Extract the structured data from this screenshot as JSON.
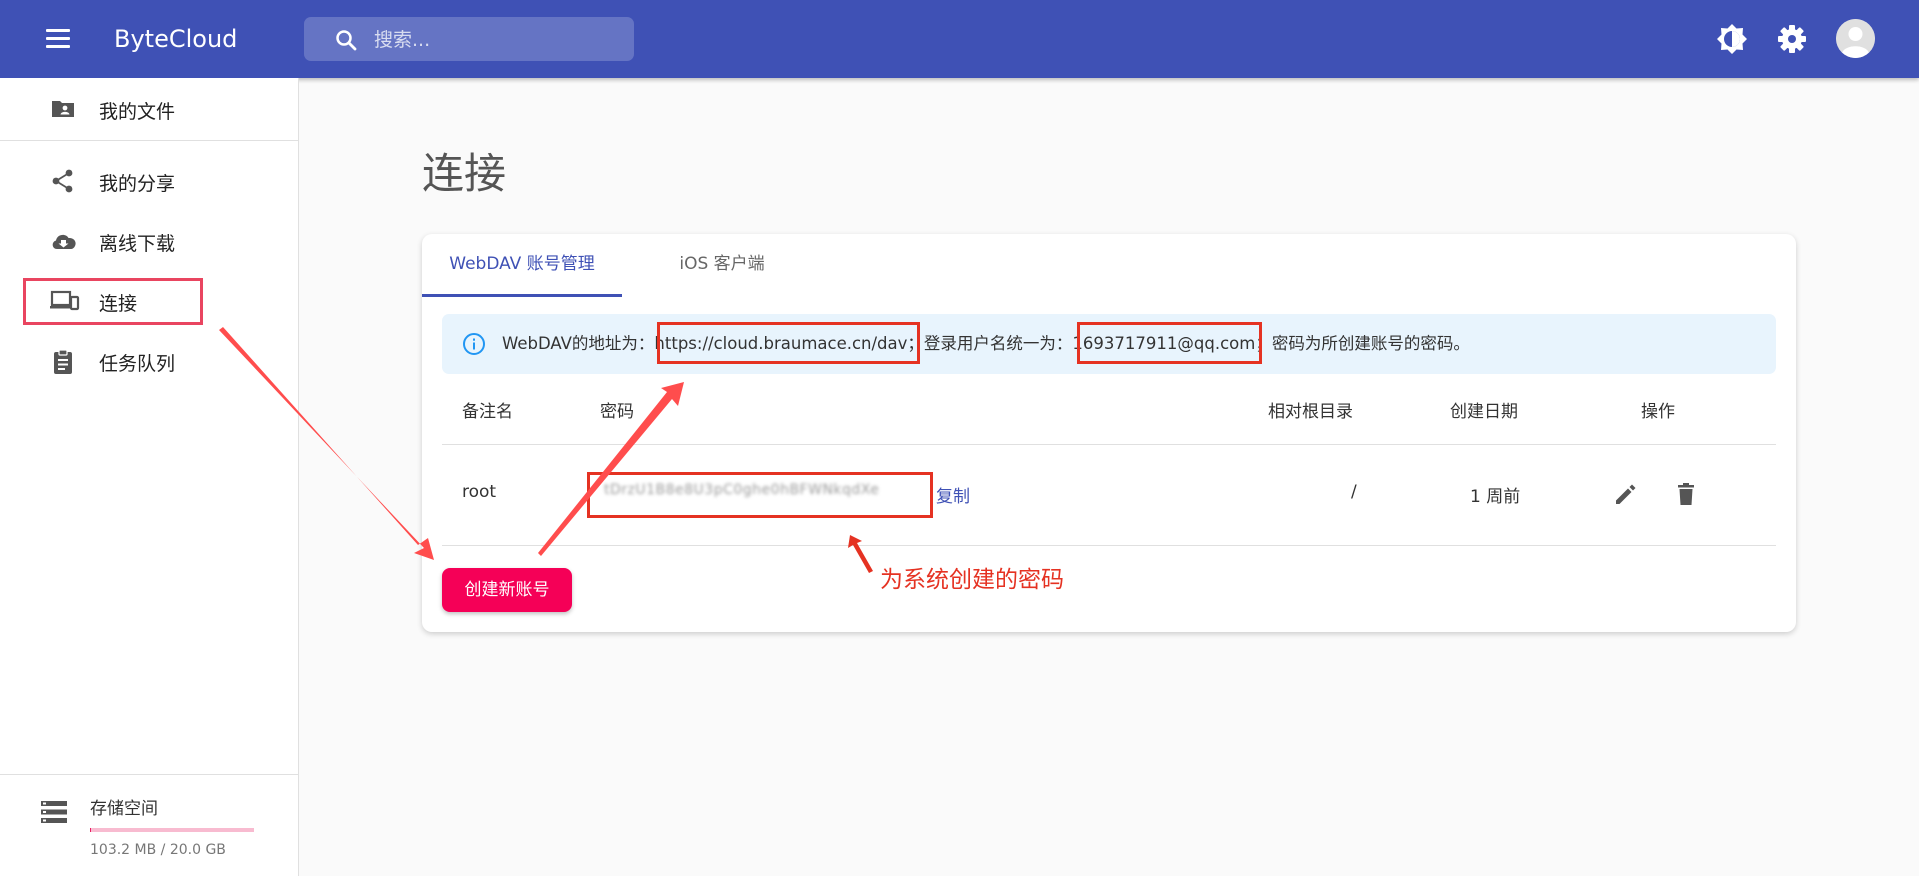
{
  "appbar": {
    "brand": "ByteCloud",
    "search_placeholder": "搜索...",
    "icons": [
      "menu-icon",
      "search-icon",
      "theme-toggle-icon",
      "settings-icon",
      "account-icon"
    ]
  },
  "sidebar": {
    "items": [
      {
        "label": "我的文件",
        "icon": "folder-user-icon"
      },
      {
        "label": "我的分享",
        "icon": "share-icon"
      },
      {
        "label": "离线下载",
        "icon": "cloud-download-icon"
      },
      {
        "label": "连接",
        "icon": "devices-icon"
      },
      {
        "label": "任务队列",
        "icon": "clipboard-icon"
      }
    ],
    "storage": {
      "title": "存储空间",
      "info": "103.2 MB / 20.0 GB",
      "used_fraction": 0.005
    }
  },
  "main": {
    "title": "连接",
    "tabs": [
      {
        "label": "WebDAV 账号管理",
        "active": true
      },
      {
        "label": "iOS 客户端",
        "active": false
      }
    ],
    "info": {
      "prefix": "WebDAV的地址为：",
      "url": "https://cloud.braumace.cn/dav",
      "mid": "；登录用户名统一为：",
      "user": "1693717911@qq.com",
      "suffix": "；密码为所创建账号的密码。"
    },
    "table": {
      "headers": [
        "备注名",
        "密码",
        "相对根目录",
        "创建日期",
        "操作"
      ],
      "rows": [
        {
          "name": "root",
          "password": "tDrzU1B8e8U3pC0ghe0hBFWNkqdXe",
          "copy": "复制",
          "root": "/",
          "date": "1 周前"
        }
      ]
    },
    "create_button": "创建新账号"
  },
  "annotation": {
    "text": "为系统创建的密码",
    "color": "#e53222"
  },
  "colors": {
    "primary": "#3f51b5",
    "accent": "#f50057",
    "info_bg": "#e8f4fd"
  }
}
